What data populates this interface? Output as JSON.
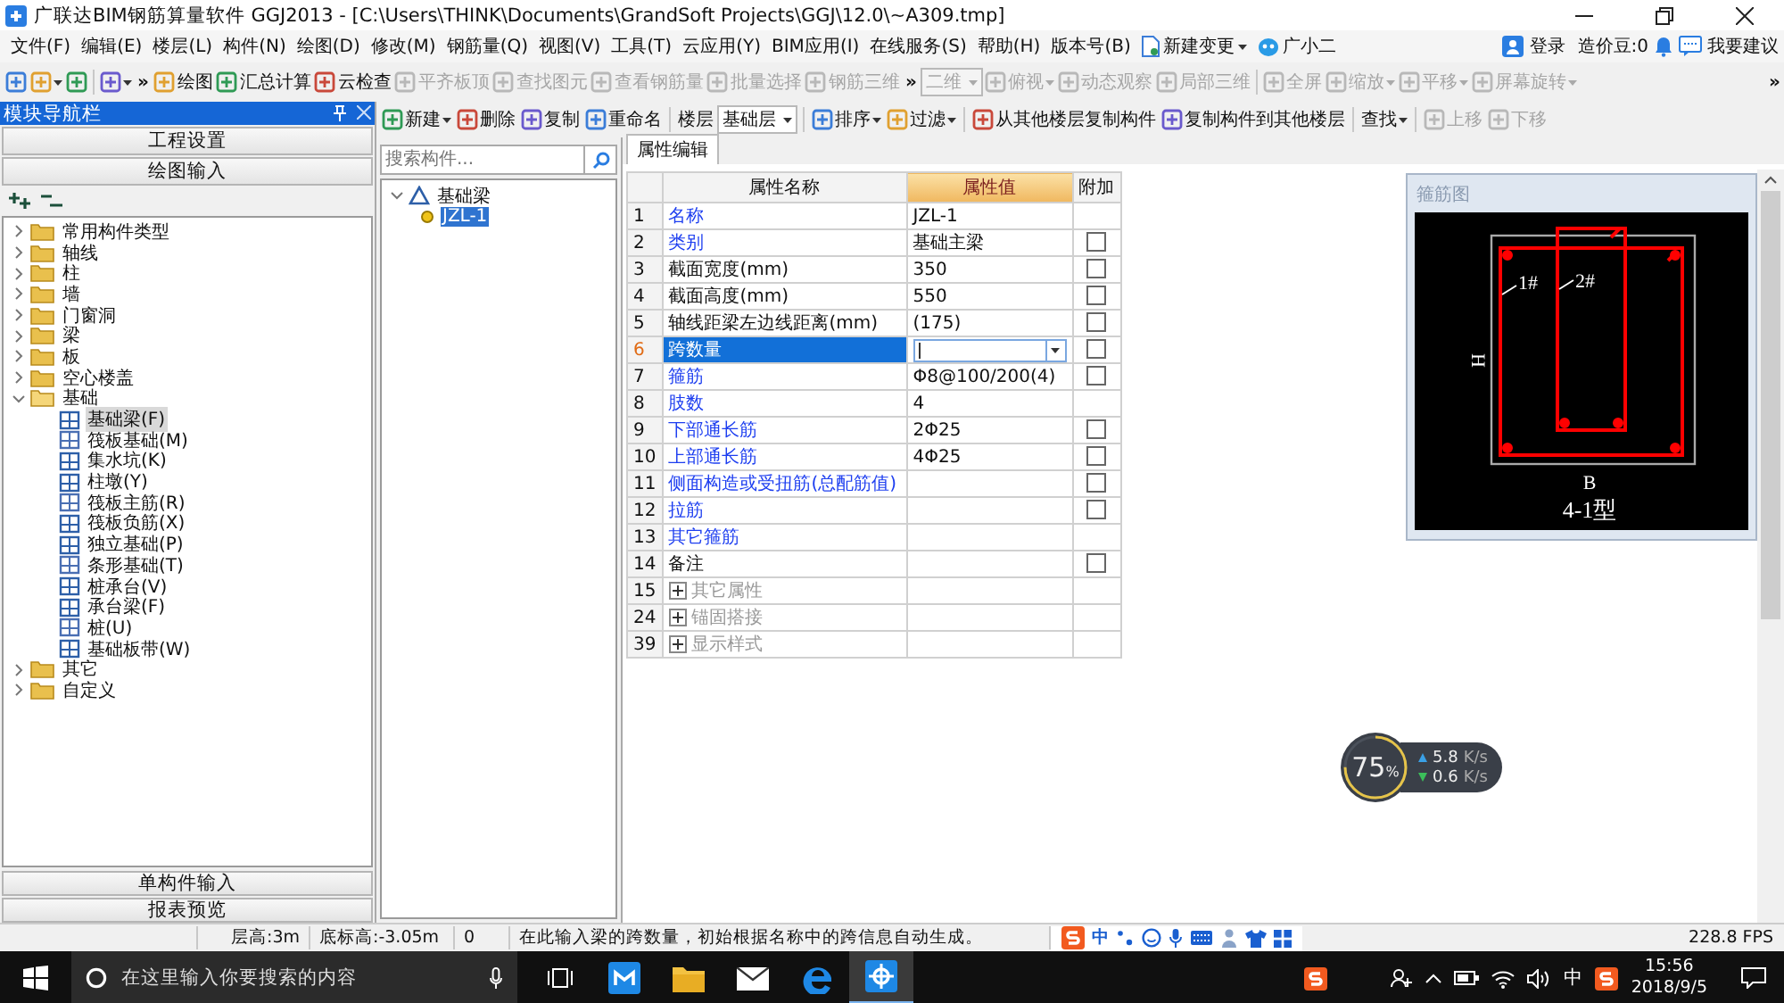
{
  "window": {
    "title": "广联达BIM钢筋算量软件 GGJ2013 - [C:\\Users\\THINK\\Documents\\GrandSoft Projects\\GGJ\\12.0\\~A309.tmp]"
  },
  "menu": [
    "文件(F)",
    "编辑(E)",
    "楼层(L)",
    "构件(N)",
    "绘图(D)",
    "修改(M)",
    "钢筋量(Q)",
    "视图(V)",
    "工具(T)",
    "云应用(Y)",
    "BIM应用(I)",
    "在线服务(S)",
    "帮助(H)",
    "版本号(B)"
  ],
  "menu_extras": [
    {
      "label": "新建变更",
      "dropdown": true
    },
    {
      "label": "广小二",
      "dropdown": false
    }
  ],
  "account": {
    "login": "登录",
    "beans": "造价豆:0",
    "feedback": "我要建议"
  },
  "toolbar": [
    {
      "kind": "icon",
      "dropdown": false,
      "disabled": false
    },
    {
      "kind": "icon",
      "dropdown": true,
      "disabled": false
    },
    {
      "kind": "icon",
      "dropdown": false,
      "disabled": false
    },
    {
      "kind": "sep"
    },
    {
      "kind": "icon",
      "dropdown": true,
      "disabled": false
    },
    {
      "kind": "chevron",
      "text": "»"
    },
    {
      "kind": "button",
      "label": "绘图",
      "dropdown": false,
      "disabled": false
    },
    {
      "kind": "button",
      "label": "汇总计算",
      "dropdown": false,
      "disabled": false
    },
    {
      "kind": "button",
      "label": "云检查",
      "dropdown": false,
      "disabled": false
    },
    {
      "kind": "button",
      "label": "平齐板顶",
      "dropdown": false,
      "disabled": true
    },
    {
      "kind": "button",
      "label": "查找图元",
      "dropdown": false,
      "disabled": true
    },
    {
      "kind": "button",
      "label": "查看钢筋量",
      "dropdown": false,
      "disabled": true
    },
    {
      "kind": "button",
      "label": "批量选择",
      "dropdown": false,
      "disabled": true
    },
    {
      "kind": "button",
      "label": "钢筋三维",
      "dropdown": false,
      "disabled": true
    },
    {
      "kind": "chevron",
      "text": "»"
    },
    {
      "kind": "combo",
      "label": "二维",
      "disabled": true
    },
    {
      "kind": "button",
      "label": "俯视",
      "dropdown": true,
      "disabled": true
    },
    {
      "kind": "button",
      "label": "动态观察",
      "dropdown": false,
      "disabled": true
    },
    {
      "kind": "button",
      "label": "局部三维",
      "dropdown": false,
      "disabled": true
    },
    {
      "kind": "sep"
    },
    {
      "kind": "button",
      "label": "全屏",
      "dropdown": false,
      "disabled": true
    },
    {
      "kind": "button",
      "label": "缩放",
      "dropdown": true,
      "disabled": true
    },
    {
      "kind": "button",
      "label": "平移",
      "dropdown": true,
      "disabled": true
    },
    {
      "kind": "button",
      "label": "屏幕旋转",
      "dropdown": true,
      "disabled": true
    },
    {
      "kind": "spacer"
    },
    {
      "kind": "chevron",
      "text": "»"
    }
  ],
  "nav": {
    "title": "模块导航栏",
    "sections": [
      "工程设置",
      "绘图输入"
    ],
    "bottom_sections": [
      "单构件输入",
      "报表预览"
    ],
    "tree": [
      {
        "label": "常用构件类型",
        "kind": "folder",
        "expanded": false,
        "selected": false
      },
      {
        "label": "轴线",
        "kind": "folder",
        "expanded": false,
        "selected": false
      },
      {
        "label": "柱",
        "kind": "folder",
        "expanded": false,
        "selected": false
      },
      {
        "label": "墙",
        "kind": "folder",
        "expanded": false,
        "selected": false
      },
      {
        "label": "门窗洞",
        "kind": "folder",
        "expanded": false,
        "selected": false
      },
      {
        "label": "梁",
        "kind": "folder",
        "expanded": false,
        "selected": false
      },
      {
        "label": "板",
        "kind": "folder",
        "expanded": false,
        "selected": false
      },
      {
        "label": "空心楼盖",
        "kind": "folder",
        "expanded": false,
        "selected": false
      },
      {
        "label": "基础",
        "kind": "folder",
        "expanded": true,
        "selected": false,
        "children": [
          {
            "label": "基础梁(F)",
            "kind": "component",
            "selected": true
          },
          {
            "label": "筏板基础(M)",
            "kind": "component",
            "selected": false
          },
          {
            "label": "集水坑(K)",
            "kind": "component",
            "selected": false
          },
          {
            "label": "柱墩(Y)",
            "kind": "component",
            "selected": false
          },
          {
            "label": "筏板主筋(R)",
            "kind": "component",
            "selected": false
          },
          {
            "label": "筏板负筋(X)",
            "kind": "component",
            "selected": false
          },
          {
            "label": "独立基础(P)",
            "kind": "component",
            "selected": false
          },
          {
            "label": "条形基础(T)",
            "kind": "component",
            "selected": false
          },
          {
            "label": "桩承台(V)",
            "kind": "component",
            "selected": false
          },
          {
            "label": "承台梁(F)",
            "kind": "component",
            "selected": false
          },
          {
            "label": "桩(U)",
            "kind": "component",
            "selected": false
          },
          {
            "label": "基础板带(W)",
            "kind": "component",
            "selected": false
          }
        ]
      },
      {
        "label": "其它",
        "kind": "folder",
        "expanded": false,
        "selected": false
      },
      {
        "label": "自定义",
        "kind": "folder",
        "expanded": false,
        "selected": false
      }
    ]
  },
  "toolbar2": [
    {
      "kind": "button",
      "label": "新建",
      "dropdown": true,
      "disabled": false
    },
    {
      "kind": "button",
      "label": "删除",
      "dropdown": false,
      "disabled": false
    },
    {
      "kind": "button",
      "label": "复制",
      "dropdown": false,
      "disabled": false
    },
    {
      "kind": "button",
      "label": "重命名",
      "dropdown": false,
      "disabled": false
    },
    {
      "kind": "sep"
    },
    {
      "kind": "text",
      "label": "楼层"
    },
    {
      "kind": "combo",
      "label": "基础层",
      "disabled": false
    },
    {
      "kind": "sep"
    },
    {
      "kind": "button",
      "label": "排序",
      "dropdown": true,
      "disabled": false
    },
    {
      "kind": "button",
      "label": "过滤",
      "dropdown": true,
      "disabled": false
    },
    {
      "kind": "sep"
    },
    {
      "kind": "button",
      "label": "从其他楼层复制构件",
      "dropdown": false,
      "disabled": false
    },
    {
      "kind": "button",
      "label": "复制构件到其他楼层",
      "dropdown": false,
      "disabled": false
    },
    {
      "kind": "sep"
    },
    {
      "kind": "menu",
      "label": "查找",
      "dropdown": true,
      "disabled": false
    },
    {
      "kind": "sep"
    },
    {
      "kind": "button",
      "label": "上移",
      "dropdown": false,
      "disabled": true
    },
    {
      "kind": "button",
      "label": "下移",
      "dropdown": false,
      "disabled": true
    }
  ],
  "components": {
    "search_placeholder": "搜索构件...",
    "tree": [
      {
        "label": "基础梁",
        "expanded": true,
        "selected": false,
        "children": [
          {
            "label": "JZL-1",
            "selected": true
          }
        ]
      }
    ]
  },
  "tabs": [
    {
      "label": "属性编辑",
      "selected": true
    }
  ],
  "table": {
    "columns": [
      {
        "label": "属性名称",
        "selected": false
      },
      {
        "label": "属性值",
        "selected": true
      },
      {
        "label": "附加",
        "selected": false
      }
    ],
    "rows": [
      {
        "num": "1",
        "kind": "prop",
        "name": "名称",
        "value": "JZL-1",
        "public": true,
        "selected": false
      },
      {
        "num": "2",
        "kind": "prop",
        "name": "类别",
        "value": "基础主梁",
        "public": true,
        "selected": false,
        "checked": false
      },
      {
        "num": "3",
        "kind": "prop",
        "name": "截面宽度(mm)",
        "value": "350",
        "public": false,
        "selected": false,
        "checked": false
      },
      {
        "num": "4",
        "kind": "prop",
        "name": "截面高度(mm)",
        "value": "550",
        "public": false,
        "selected": false,
        "checked": false
      },
      {
        "num": "5",
        "kind": "prop",
        "name": "轴线距梁左边线距离(mm)",
        "value": "(175)",
        "public": false,
        "selected": false,
        "checked": false
      },
      {
        "num": "6",
        "kind": "prop",
        "name": "跨数量",
        "public": true,
        "selected": true,
        "checked": false
      },
      {
        "num": "7",
        "kind": "prop",
        "name": "箍筋",
        "value": "Φ8@100/200(4)",
        "public": true,
        "selected": false,
        "checked": false
      },
      {
        "num": "8",
        "kind": "prop",
        "name": "肢数",
        "value": "4",
        "public": true,
        "selected": false
      },
      {
        "num": "9",
        "kind": "prop",
        "name": "下部通长筋",
        "value": "2Φ25",
        "public": true,
        "selected": false,
        "checked": false
      },
      {
        "num": "10",
        "kind": "prop",
        "name": "上部通长筋",
        "value": "4Φ25",
        "public": true,
        "selected": false,
        "checked": false
      },
      {
        "num": "11",
        "kind": "prop",
        "name": "侧面构造或受扭筋(总配筋值)",
        "public": true,
        "selected": false,
        "checked": false
      },
      {
        "num": "12",
        "kind": "prop",
        "name": "拉筋",
        "public": true,
        "selected": false,
        "checked": false
      },
      {
        "num": "13",
        "kind": "prop",
        "name": "其它箍筋",
        "public": true,
        "selected": false
      },
      {
        "num": "14",
        "kind": "prop",
        "name": "备注",
        "public": false,
        "selected": false,
        "checked": false
      },
      {
        "num": "15",
        "kind": "group",
        "name": "其它属性",
        "selected": false
      },
      {
        "num": "24",
        "kind": "group",
        "name": "锚固搭接",
        "selected": false
      },
      {
        "num": "39",
        "kind": "group",
        "name": "显示样式",
        "selected": false
      }
    ]
  },
  "preview": {
    "title": "箍筋图",
    "label_1": "1#",
    "label_2": "2#",
    "height": "H",
    "width": "B",
    "caption": "4-1型"
  },
  "net_widget": {
    "percent": "75",
    "unit": "%",
    "upload": "5.8",
    "upload_unit": "K/s",
    "download": "0.6",
    "download_unit": "K/s"
  },
  "status_bar": {
    "cells": [
      "层高:3m",
      "底标高:-3.05m",
      "0",
      "在此输入梁的跨数量，初始根据名称中的跨信息自动生成。"
    ],
    "ime": "中",
    "fps": "228.8 FPS"
  },
  "taskbar": {
    "search_placeholder": "在这里输入你要搜索的内容",
    "apps": [
      {
        "selected": false
      },
      {
        "selected": false
      },
      {
        "selected": false
      },
      {
        "selected": false
      },
      {
        "selected": true
      }
    ],
    "ime": "中",
    "time": "15:56",
    "date": "2018/9/5"
  }
}
